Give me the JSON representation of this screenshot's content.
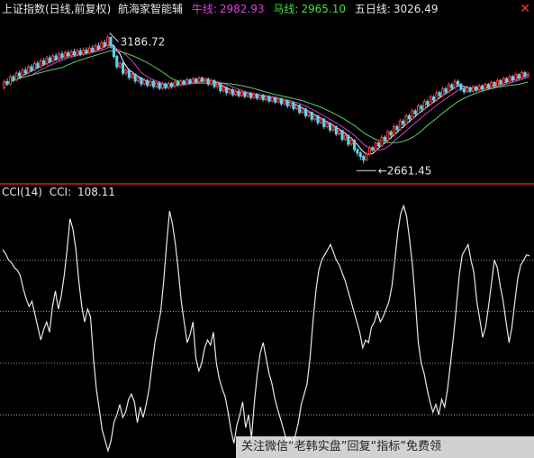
{
  "header": {
    "title": "上证指数(日线,前复权)",
    "indicator_name": "航海家智能辅",
    "ma1_label": "牛线:",
    "ma1_value": "2982.93",
    "ma2_label": "马线:",
    "ma2_value": "2965.10",
    "ma3_label": "五日线:",
    "ma3_value": "3026.49",
    "close_icon": "close-icon"
  },
  "cci_header": {
    "name": "CCI(14)",
    "label": "CCI:",
    "value": "108.11"
  },
  "watermark": "关注微信“老韩实盘”回复“指标”免费领",
  "colors": {
    "background": "#000000",
    "up_candle": "#ff3c3c",
    "down_candle": "#5fd3f3",
    "ma1": "#d040d0",
    "ma2": "#60d060",
    "ma5": "#ffffff",
    "cci_line": "#e8e8e8",
    "divider": "#c81e1e",
    "title_text": "#e6e6e6",
    "ma1_text": "#e040e0",
    "ma2_text": "#40e040",
    "ma3_text": "#e6e6e6"
  },
  "chart_data": [
    {
      "type": "candlestick",
      "title": "上证指数(日线,前复权)",
      "ylim": [
        2600,
        3240
      ],
      "annotations": [
        {
          "text": "3186.72",
          "label": "high",
          "value": 3186.72,
          "index": 34
        },
        {
          "text": "2661.45",
          "label": "low",
          "value": 2661.45,
          "index": 118
        }
      ],
      "candles": [
        [
          2970,
          2995,
          3004,
          2962
        ],
        [
          2995,
          2985,
          3008,
          2977
        ],
        [
          2985,
          3015,
          3024,
          2980
        ],
        [
          3015,
          3002,
          3024,
          2993
        ],
        [
          3002,
          3030,
          3038,
          2997
        ],
        [
          3030,
          3018,
          3040,
          3010
        ],
        [
          3018,
          3042,
          3051,
          3012
        ],
        [
          3042,
          3031,
          3054,
          3024
        ],
        [
          3031,
          3056,
          3064,
          3026
        ],
        [
          3056,
          3043,
          3066,
          3035
        ],
        [
          3043,
          3070,
          3079,
          3038
        ],
        [
          3070,
          3055,
          3080,
          3047
        ],
        [
          3055,
          3080,
          3090,
          3049
        ],
        [
          3080,
          3068,
          3092,
          3060
        ],
        [
          3068,
          3092,
          3101,
          3062
        ],
        [
          3092,
          3078,
          3103,
          3069
        ],
        [
          3078,
          3100,
          3110,
          3072
        ],
        [
          3100,
          3086,
          3112,
          3078
        ],
        [
          3086,
          3108,
          3117,
          3080
        ],
        [
          3108,
          3094,
          3120,
          3085
        ],
        [
          3094,
          3113,
          3122,
          3088
        ],
        [
          3113,
          3100,
          3124,
          3092
        ],
        [
          3100,
          3118,
          3127,
          3094
        ],
        [
          3118,
          3104,
          3130,
          3096
        ],
        [
          3104,
          3121,
          3130,
          3098
        ],
        [
          3121,
          3106,
          3132,
          3098
        ],
        [
          3106,
          3124,
          3134,
          3100
        ],
        [
          3124,
          3112,
          3136,
          3104
        ],
        [
          3112,
          3132,
          3142,
          3106
        ],
        [
          3132,
          3120,
          3144,
          3112
        ],
        [
          3120,
          3141,
          3151,
          3115
        ],
        [
          3141,
          3130,
          3154,
          3122
        ],
        [
          3130,
          3154,
          3163,
          3125
        ],
        [
          3154,
          3142,
          3166,
          3134
        ],
        [
          3142,
          3176,
          3187,
          3136
        ],
        [
          3176,
          3140,
          3180,
          3130
        ],
        [
          3140,
          3098,
          3145,
          3088
        ],
        [
          3098,
          3056,
          3104,
          3046
        ],
        [
          3056,
          3070,
          3078,
          3048
        ],
        [
          3070,
          3030,
          3075,
          3020
        ],
        [
          3030,
          3042,
          3050,
          3020
        ],
        [
          3042,
          3012,
          3048,
          3002
        ],
        [
          3012,
          3025,
          3032,
          3004
        ],
        [
          3025,
          2998,
          3030,
          2988
        ],
        [
          2998,
          3010,
          3018,
          2990
        ],
        [
          3010,
          2986,
          3016,
          2976
        ],
        [
          2986,
          3000,
          3008,
          2980
        ],
        [
          3000,
          2980,
          3006,
          2972
        ],
        [
          2980,
          2996,
          3004,
          2974
        ],
        [
          2996,
          2975,
          3002,
          2966
        ],
        [
          2975,
          2990,
          2998,
          2968
        ],
        [
          2990,
          2968,
          2996,
          2960
        ],
        [
          2968,
          2985,
          2994,
          2962
        ],
        [
          2985,
          2970,
          2992,
          2962
        ],
        [
          2970,
          2988,
          2996,
          2964
        ],
        [
          2988,
          2975,
          2994,
          2966
        ],
        [
          2975,
          2994,
          3002,
          2970
        ],
        [
          2994,
          2982,
          3000,
          2974
        ],
        [
          2982,
          2998,
          3006,
          2976
        ],
        [
          2998,
          2986,
          3004,
          2978
        ],
        [
          2986,
          3003,
          3012,
          2980
        ],
        [
          3003,
          2990,
          3008,
          2982
        ],
        [
          2990,
          3006,
          3014,
          2984
        ],
        [
          3006,
          2994,
          3012,
          2986
        ],
        [
          2994,
          3010,
          3018,
          2988
        ],
        [
          3010,
          2997,
          3016,
          2988
        ],
        [
          2997,
          3006,
          3014,
          2990
        ],
        [
          3006,
          2985,
          3012,
          2976
        ],
        [
          2985,
          3000,
          3008,
          2978
        ],
        [
          3000,
          2975,
          3004,
          2966
        ],
        [
          2975,
          2985,
          2992,
          2966
        ],
        [
          2985,
          2958,
          2990,
          2948
        ],
        [
          2958,
          2972,
          2980,
          2950
        ],
        [
          2972,
          2950,
          2976,
          2940
        ],
        [
          2950,
          2962,
          2970,
          2942
        ],
        [
          2962,
          2942,
          2968,
          2934
        ],
        [
          2942,
          2956,
          2964,
          2936
        ],
        [
          2956,
          2938,
          2962,
          2930
        ],
        [
          2938,
          2952,
          2960,
          2932
        ],
        [
          2952,
          2935,
          2958,
          2926
        ],
        [
          2935,
          2948,
          2956,
          2928
        ],
        [
          2948,
          2930,
          2954,
          2922
        ],
        [
          2930,
          2944,
          2952,
          2924
        ],
        [
          2944,
          2928,
          2950,
          2920
        ],
        [
          2928,
          2940,
          2948,
          2920
        ],
        [
          2940,
          2922,
          2946,
          2914
        ],
        [
          2922,
          2935,
          2942,
          2914
        ],
        [
          2935,
          2916,
          2940,
          2908
        ],
        [
          2916,
          2930,
          2938,
          2910
        ],
        [
          2930,
          2912,
          2935,
          2904
        ],
        [
          2912,
          2926,
          2934,
          2906
        ],
        [
          2926,
          2905,
          2930,
          2896
        ],
        [
          2905,
          2918,
          2926,
          2898
        ],
        [
          2918,
          2896,
          2922,
          2886
        ],
        [
          2896,
          2910,
          2918,
          2888
        ],
        [
          2910,
          2885,
          2914,
          2876
        ],
        [
          2885,
          2898,
          2906,
          2878
        ],
        [
          2898,
          2870,
          2902,
          2860
        ],
        [
          2870,
          2884,
          2892,
          2862
        ],
        [
          2884,
          2856,
          2888,
          2846
        ],
        [
          2856,
          2870,
          2878,
          2848
        ],
        [
          2870,
          2842,
          2874,
          2832
        ],
        [
          2842,
          2856,
          2864,
          2834
        ],
        [
          2856,
          2828,
          2860,
          2818
        ],
        [
          2828,
          2842,
          2850,
          2820
        ],
        [
          2842,
          2812,
          2846,
          2802
        ],
        [
          2812,
          2826,
          2834,
          2804
        ],
        [
          2826,
          2798,
          2830,
          2788
        ],
        [
          2798,
          2812,
          2820,
          2790
        ],
        [
          2812,
          2782,
          2816,
          2772
        ],
        [
          2782,
          2796,
          2804,
          2774
        ],
        [
          2796,
          2760,
          2800,
          2750
        ],
        [
          2760,
          2776,
          2784,
          2752
        ],
        [
          2776,
          2740,
          2780,
          2730
        ],
        [
          2740,
          2756,
          2764,
          2732
        ],
        [
          2756,
          2718,
          2760,
          2708
        ],
        [
          2718,
          2704,
          2724,
          2690
        ],
        [
          2704,
          2690,
          2712,
          2675
        ],
        [
          2690,
          2676,
          2698,
          2661
        ],
        [
          2676,
          2700,
          2708,
          2670
        ],
        [
          2700,
          2726,
          2734,
          2694
        ],
        [
          2726,
          2716,
          2732,
          2708
        ],
        [
          2716,
          2745,
          2754,
          2710
        ],
        [
          2745,
          2734,
          2752,
          2726
        ],
        [
          2734,
          2768,
          2778,
          2728
        ],
        [
          2768,
          2756,
          2776,
          2748
        ],
        [
          2756,
          2790,
          2800,
          2750
        ],
        [
          2790,
          2778,
          2798,
          2770
        ],
        [
          2778,
          2812,
          2822,
          2772
        ],
        [
          2812,
          2800,
          2820,
          2792
        ],
        [
          2800,
          2834,
          2844,
          2794
        ],
        [
          2834,
          2822,
          2842,
          2814
        ],
        [
          2822,
          2856,
          2866,
          2816
        ],
        [
          2856,
          2844,
          2864,
          2836
        ],
        [
          2844,
          2876,
          2886,
          2838
        ],
        [
          2876,
          2864,
          2884,
          2856
        ],
        [
          2864,
          2896,
          2906,
          2858
        ],
        [
          2896,
          2884,
          2904,
          2876
        ],
        [
          2884,
          2914,
          2924,
          2878
        ],
        [
          2914,
          2902,
          2922,
          2894
        ],
        [
          2902,
          2932,
          2942,
          2896
        ],
        [
          2932,
          2920,
          2940,
          2912
        ],
        [
          2920,
          2950,
          2960,
          2914
        ],
        [
          2950,
          2938,
          2958,
          2930
        ],
        [
          2938,
          2966,
          2976,
          2932
        ],
        [
          2966,
          2954,
          2974,
          2946
        ],
        [
          2954,
          2982,
          2992,
          2948
        ],
        [
          2982,
          2970,
          2990,
          2962
        ],
        [
          2970,
          2996,
          3006,
          2964
        ],
        [
          2996,
          2984,
          3004,
          2976
        ],
        [
          2984,
          2966,
          2990,
          2956
        ],
        [
          2966,
          2954,
          2972,
          2944
        ],
        [
          2954,
          2970,
          2978,
          2948
        ],
        [
          2970,
          2956,
          2976,
          2948
        ],
        [
          2956,
          2974,
          2982,
          2950
        ],
        [
          2974,
          2960,
          2980,
          2952
        ],
        [
          2960,
          2978,
          2986,
          2954
        ],
        [
          2978,
          2964,
          2984,
          2956
        ],
        [
          2964,
          2984,
          2992,
          2958
        ],
        [
          2984,
          2970,
          2990,
          2962
        ],
        [
          2970,
          2992,
          3000,
          2964
        ],
        [
          2992,
          2978,
          2998,
          2970
        ],
        [
          2978,
          3000,
          3008,
          2972
        ],
        [
          3000,
          2986,
          3006,
          2978
        ],
        [
          2986,
          3008,
          3016,
          2980
        ],
        [
          3008,
          2994,
          3014,
          2986
        ],
        [
          2994,
          3016,
          3024,
          2988
        ],
        [
          3016,
          3002,
          3022,
          2994
        ],
        [
          3002,
          3024,
          3032,
          2996
        ],
        [
          3024,
          3010,
          3030,
          3002
        ],
        [
          3010,
          3032,
          3040,
          3004
        ],
        [
          3032,
          3018,
          3038,
          3010
        ],
        [
          3018,
          3026,
          3036,
          3010
        ]
      ]
    },
    {
      "type": "line",
      "title": "CCI(14)",
      "series": [
        {
          "name": "CCI",
          "values": [
            120,
            112,
            100,
            95,
            85,
            80,
            70,
            45,
            25,
            10,
            20,
            -5,
            -30,
            -55,
            -35,
            -20,
            -40,
            10,
            40,
            5,
            30,
            70,
            120,
            180,
            160,
            120,
            60,
            10,
            -20,
            5,
            -10,
            -90,
            -150,
            -190,
            -230,
            -250,
            -270,
            -250,
            -215,
            -200,
            -180,
            -205,
            -195,
            -170,
            -160,
            -175,
            -215,
            -185,
            -205,
            -180,
            -150,
            -105,
            -60,
            -30,
            0,
            60,
            130,
            195,
            170,
            130,
            80,
            20,
            -20,
            -60,
            -45,
            -20,
            -90,
            -115,
            -100,
            -70,
            -55,
            -65,
            -40,
            -100,
            -130,
            -150,
            -165,
            -195,
            -230,
            -255,
            -220,
            -200,
            -175,
            -225,
            -200,
            -245,
            -175,
            -120,
            -80,
            -60,
            -90,
            -120,
            -140,
            -170,
            -190,
            -210,
            -230,
            -250,
            -245,
            -255,
            -240,
            -215,
            -180,
            -160,
            -140,
            -90,
            -20,
            40,
            80,
            100,
            110,
            120,
            130,
            115,
            100,
            90,
            75,
            60,
            40,
            20,
            0,
            -20,
            -40,
            -70,
            -55,
            -60,
            -30,
            -20,
            0,
            -20,
            -10,
            5,
            20,
            50,
            100,
            155,
            190,
            205,
            185,
            140,
            90,
            20,
            -60,
            -100,
            -120,
            -150,
            -175,
            -195,
            -180,
            -200,
            -170,
            -185,
            -150,
            -100,
            -50,
            10,
            70,
            110,
            120,
            130,
            100,
            75,
            20,
            -15,
            -50,
            -30,
            10,
            55,
            100,
            85,
            50,
            20,
            -20,
            -60,
            -30,
            20,
            65,
            90,
            100,
            110,
            108
          ],
          "labels": []
        }
      ],
      "reference_lines": [
        100,
        0,
        -100,
        -200
      ]
    }
  ]
}
